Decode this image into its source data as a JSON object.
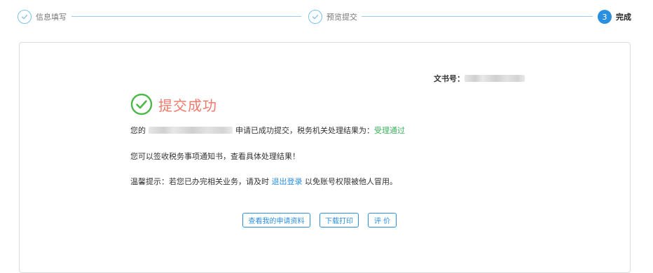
{
  "stepper": {
    "steps": [
      {
        "label": "信息填写",
        "state": "done"
      },
      {
        "label": "预览提交",
        "state": "done"
      },
      {
        "number": "3",
        "label": "完成",
        "state": "active"
      }
    ]
  },
  "result": {
    "doc_number_label": "文书号：",
    "title": "提交成功",
    "line1_prefix": "您的",
    "line1_middle": "申请已成功提交，税务机关处理结果为：",
    "status": "受理通过",
    "line2": "您可以签收税务事项通知书，查看具体处理结果！",
    "tip_prefix": "温馨提示：若您已办完相关业务，请及时",
    "logout_link": "退出登录",
    "tip_suffix": "以免账号权限被他人冒用。"
  },
  "buttons": {
    "view_application": "查看我的申请资料",
    "download_print": "下载打印",
    "evaluate": "评 价"
  },
  "colors": {
    "primary": "#2b8fe0",
    "success_icon": "#4cb848",
    "success_title": "#f07a6c",
    "status_text": "#3cb35c"
  }
}
